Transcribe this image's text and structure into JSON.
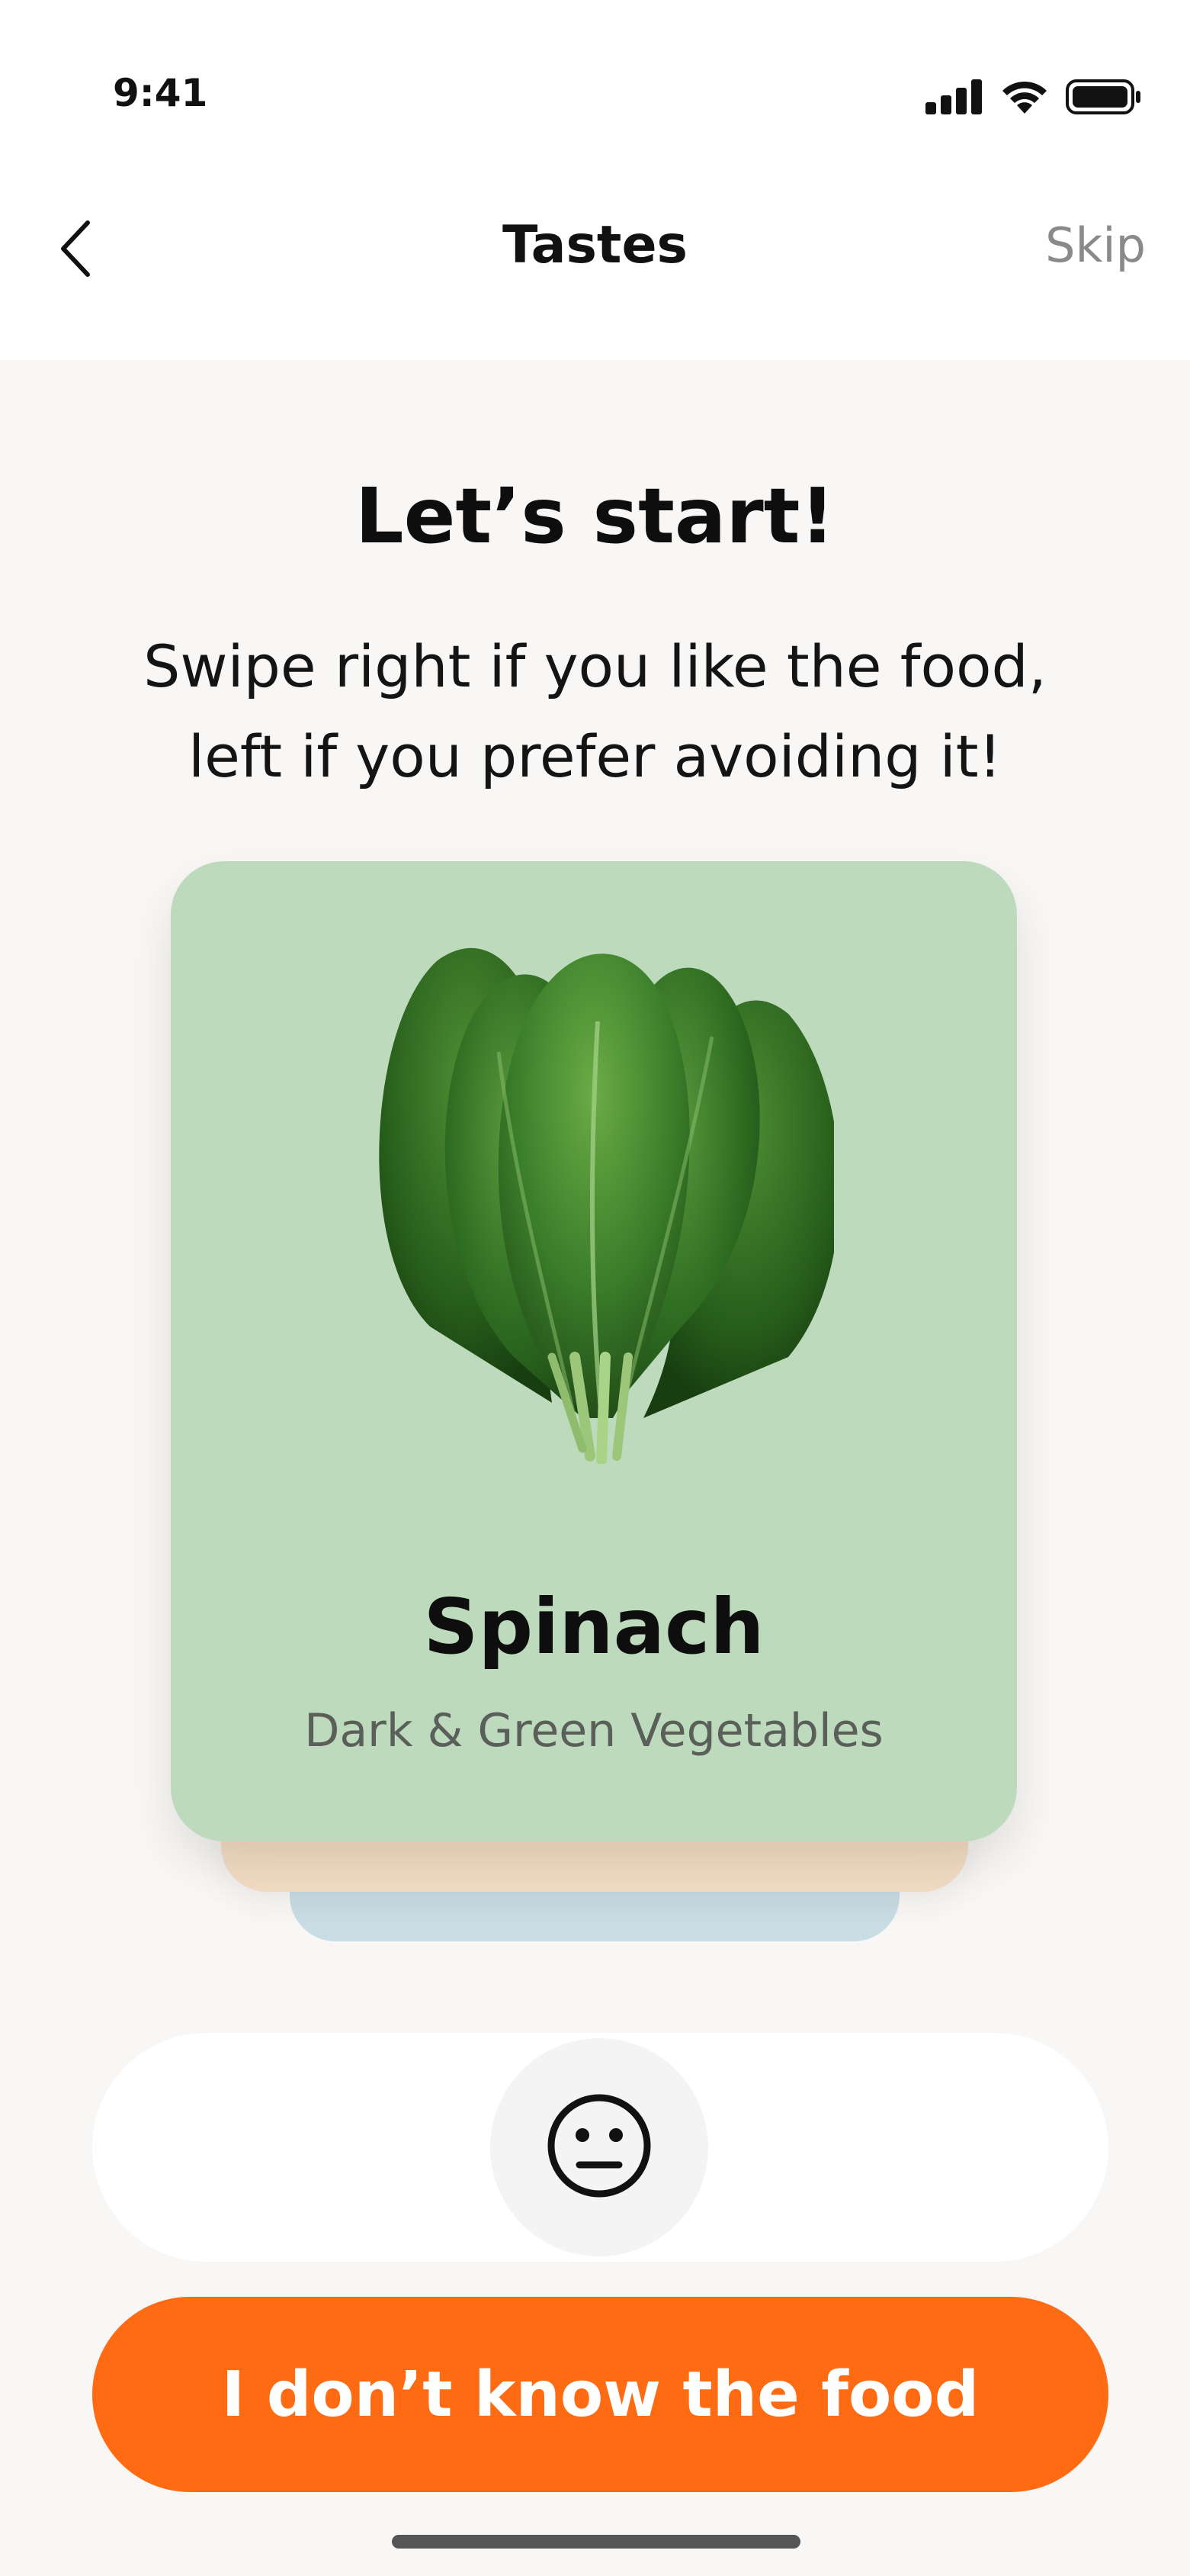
{
  "status_bar": {
    "time": "9:41",
    "icons": [
      "signal-icon",
      "wifi-icon",
      "battery-icon"
    ]
  },
  "nav": {
    "back_icon": "chevron-left-icon",
    "title": "Tastes",
    "skip_label": "Skip"
  },
  "intro": {
    "title": "Let’s start!",
    "subtitle": "Swipe right if you like the food, left if you prefer avoiding it!"
  },
  "card": {
    "image_icon": "spinach-leaves-image",
    "name": "Spinach",
    "category": "Dark & Green Vegetables",
    "background_color": "#bedabd",
    "stack_colors": [
      "#f3dcc4",
      "#c9dde4"
    ]
  },
  "reaction": {
    "icon": "neutral-face-icon"
  },
  "cta": {
    "label": "I don’t know the food",
    "color": "#ff6b13"
  }
}
